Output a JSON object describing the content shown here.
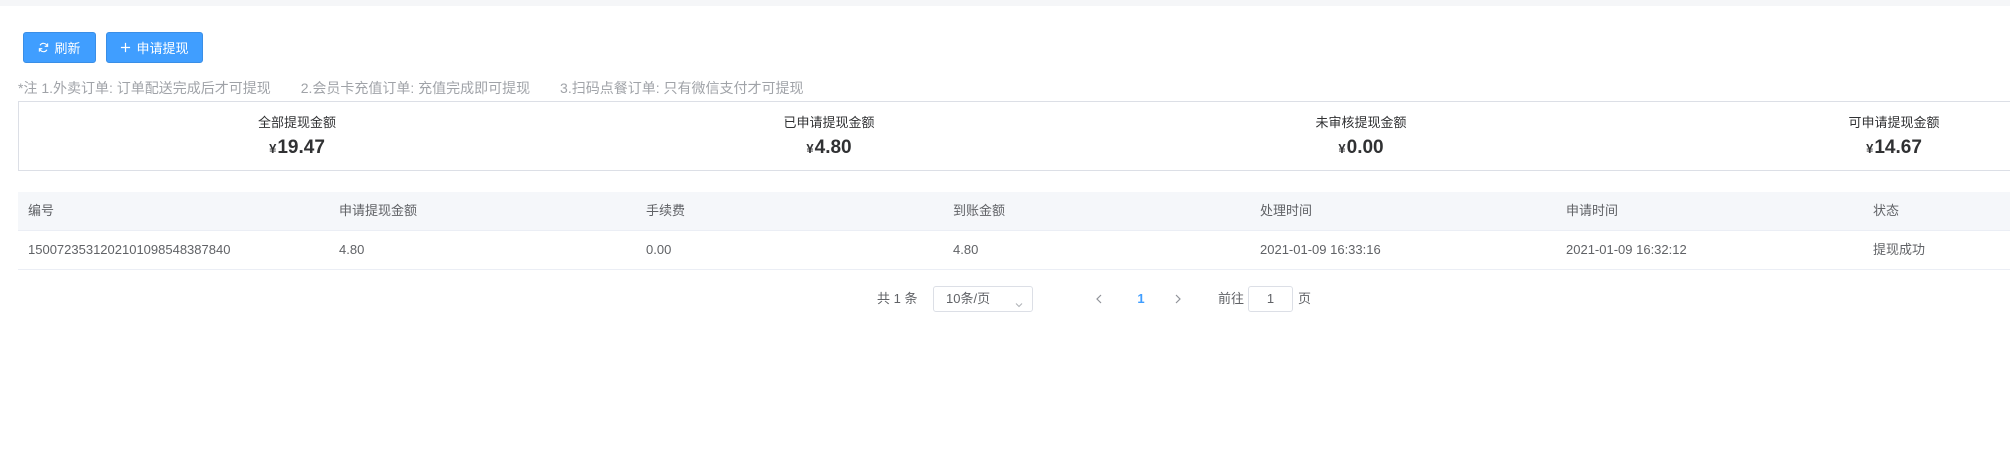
{
  "toolbar": {
    "refresh_label": "刷新",
    "apply_label": "申请提现"
  },
  "notes": [
    "*注 1.外卖订单: 订单配送完成后才可提现",
    "2.会员卡充值订单: 充值完成即可提现",
    "3.扫码点餐订单: 只有微信支付才可提现"
  ],
  "summary": [
    {
      "label": "全部提现金额",
      "currency": "¥",
      "value": "19.47"
    },
    {
      "label": "已申请提现金额",
      "currency": "¥",
      "value": "4.80"
    },
    {
      "label": "未审核提现金额",
      "currency": "¥",
      "value": "0.00"
    },
    {
      "label": "可申请提现金额",
      "currency": "¥",
      "value": "14.67"
    }
  ],
  "table": {
    "columns": [
      "编号",
      "申请提现金额",
      "手续费",
      "到账金额",
      "处理时间",
      "申请时间",
      "状态"
    ],
    "rows": [
      [
        "15007235312021010985483878​40",
        "4.80",
        "0.00",
        "4.80",
        "2021-01-09 16:33:16",
        "2021-01-09 16:32:12",
        "提现成功"
      ]
    ]
  },
  "pagination": {
    "total": "共 1 条",
    "page_size": "10条/页",
    "current_page": "1",
    "goto_label": "前往",
    "goto_value": "1",
    "goto_unit": "页"
  },
  "colors": {
    "primary": "#409eff",
    "header_bg": "#f5f7fa",
    "border": "#dcdfe6"
  }
}
